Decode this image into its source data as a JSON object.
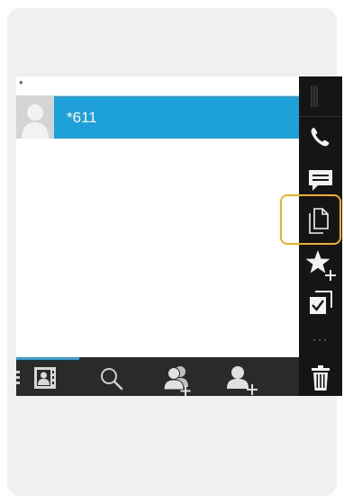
{
  "list": {
    "section_header": "*",
    "contacts": [
      {
        "name": "*611"
      }
    ]
  },
  "bottom_bar": {
    "tabs": [
      {
        "icon": "contacts-book-icon",
        "selected": true
      },
      {
        "icon": "search-icon"
      },
      {
        "icon": "add-group-icon"
      },
      {
        "icon": "add-contact-icon"
      }
    ]
  },
  "action_bar": {
    "items": [
      {
        "icon": "handle-grip-icon"
      },
      {
        "icon": "phone-icon"
      },
      {
        "icon": "message-icon"
      },
      {
        "icon": "copy-document-icon",
        "highlighted": true
      },
      {
        "icon": "add-favorite-icon"
      },
      {
        "icon": "select-items-icon"
      },
      {
        "icon": "overflow-dots-icon"
      },
      {
        "icon": "trash-icon"
      }
    ]
  },
  "colors": {
    "accent": "#1ea0d8",
    "action_bar_bg": "#151515",
    "bottom_bar_bg": "#2a2a2a",
    "highlight": "#f0b020"
  }
}
